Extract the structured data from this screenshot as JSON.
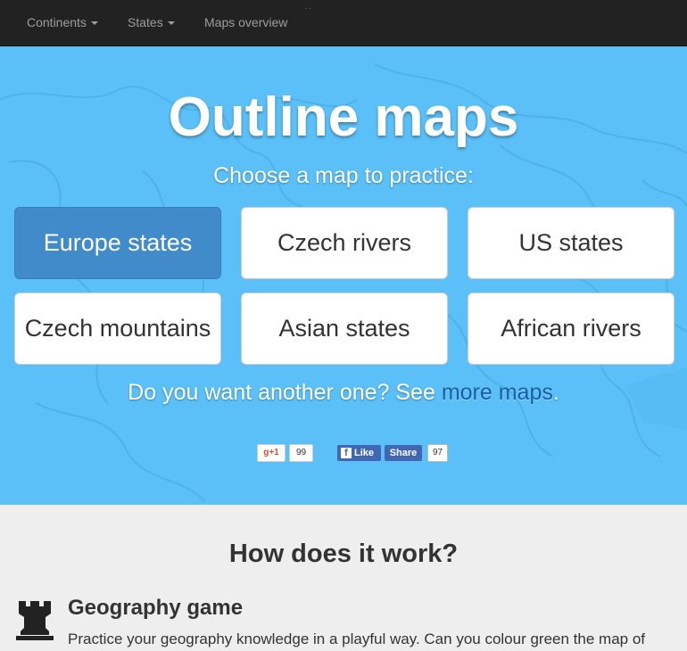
{
  "navbar": {
    "items": [
      {
        "label": "Continents",
        "dropdown": true
      },
      {
        "label": "States",
        "dropdown": true
      },
      {
        "label": "Maps overview",
        "dropdown": false
      }
    ]
  },
  "hero": {
    "title": "Outline maps",
    "subtitle": "Choose a map to practice:",
    "maps": [
      {
        "label": "Europe states",
        "active": true
      },
      {
        "label": "Czech rivers",
        "active": false
      },
      {
        "label": "US states",
        "active": false
      },
      {
        "label": "Czech mountains",
        "active": false
      },
      {
        "label": "Asian states",
        "active": false
      },
      {
        "label": "African rivers",
        "active": false
      }
    ],
    "more_prefix": "Do you want another one? See ",
    "more_link": "more maps",
    "more_suffix": "."
  },
  "social": {
    "gplus_label": "+1",
    "gplus_count": "99",
    "fb_like_label": "Like",
    "fb_share_label": "Share",
    "fb_count": "97"
  },
  "how": {
    "title": "How does it work?",
    "feature": {
      "icon": "chess-rook-icon",
      "title": "Geography game",
      "text": "Practice your geography knowledge in a playful way. Can you colour green the map of"
    }
  },
  "colors": {
    "navbar_bg": "#222222",
    "hero_bg": "#5bc0f8",
    "active_button": "#428bca",
    "link": "#1a5fa0",
    "facebook": "#4267b2"
  }
}
